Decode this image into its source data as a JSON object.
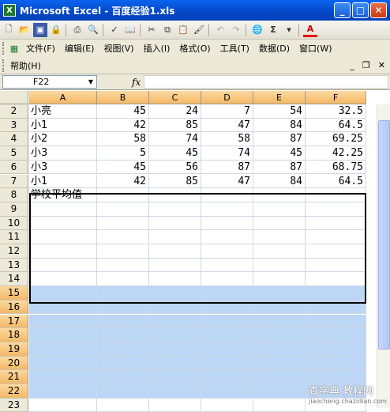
{
  "window": {
    "title": "Microsoft Excel - 百度经验1.xls",
    "app_icon": "X"
  },
  "toolbar": {
    "icons": [
      "new-icon",
      "open-icon",
      "save-icon",
      "permission-icon",
      "print-icon",
      "print-preview-icon",
      "spelling-icon",
      "research-icon",
      "cut-icon",
      "copy-icon",
      "paste-icon",
      "format-painter-icon",
      "undo-icon",
      "redo-icon",
      "hyperlink-icon",
      "autosum-icon",
      "sort-icon",
      "font-color-icon"
    ],
    "autosum_label": "Σ",
    "font_color_label": "A"
  },
  "menu": {
    "row1": [
      "文件(F)",
      "编辑(E)",
      "视图(V)",
      "插入(I)",
      "格式(O)",
      "工具(T)",
      "数据(D)",
      "窗口(W)"
    ],
    "row2": [
      "帮助(H)"
    ]
  },
  "formula_bar": {
    "name_box": "F22",
    "fx_label": "fx",
    "value": ""
  },
  "columns": [
    "A",
    "B",
    "C",
    "D",
    "E",
    "F"
  ],
  "rows": [
    {
      "n": "2",
      "cells": [
        "小亮",
        "45",
        "24",
        "7",
        "54",
        "32.5"
      ]
    },
    {
      "n": "3",
      "cells": [
        "小1",
        "42",
        "85",
        "47",
        "84",
        "64.5"
      ]
    },
    {
      "n": "4",
      "cells": [
        "小2",
        "58",
        "74",
        "58",
        "87",
        "69.25"
      ]
    },
    {
      "n": "5",
      "cells": [
        "小3",
        "5",
        "45",
        "74",
        "45",
        "42.25"
      ]
    },
    {
      "n": "6",
      "cells": [
        "小3",
        "45",
        "56",
        "87",
        "87",
        "68.75"
      ]
    },
    {
      "n": "7",
      "cells": [
        "小1",
        "42",
        "85",
        "47",
        "84",
        "64.5"
      ]
    },
    {
      "n": "8",
      "cells": [
        "学校平均值",
        "",
        "",
        "",
        "",
        ""
      ]
    },
    {
      "n": "9",
      "cells": [
        "",
        "",
        "",
        "",
        "",
        ""
      ]
    },
    {
      "n": "10",
      "cells": [
        "",
        "",
        "",
        "",
        "",
        ""
      ]
    },
    {
      "n": "11",
      "cells": [
        "",
        "",
        "",
        "",
        "",
        ""
      ]
    },
    {
      "n": "12",
      "cells": [
        "",
        "",
        "",
        "",
        "",
        ""
      ]
    },
    {
      "n": "13",
      "cells": [
        "",
        "",
        "",
        "",
        "",
        ""
      ]
    },
    {
      "n": "14",
      "cells": [
        "",
        "",
        "",
        "",
        "",
        ""
      ]
    },
    {
      "n": "15",
      "cells": [
        "",
        "",
        "",
        "",
        "",
        ""
      ]
    },
    {
      "n": "16",
      "cells": [
        "",
        "",
        "",
        "",
        "",
        ""
      ]
    },
    {
      "n": "17",
      "cells": [
        "",
        "",
        "",
        "",
        "",
        ""
      ]
    },
    {
      "n": "18",
      "cells": [
        "",
        "",
        "",
        "",
        "",
        ""
      ]
    },
    {
      "n": "19",
      "cells": [
        "",
        "",
        "",
        "",
        "",
        ""
      ]
    },
    {
      "n": "20",
      "cells": [
        "",
        "",
        "",
        "",
        "",
        ""
      ]
    },
    {
      "n": "21",
      "cells": [
        "",
        "",
        "",
        "",
        "",
        ""
      ]
    },
    {
      "n": "22",
      "cells": [
        "",
        "",
        "",
        "",
        "",
        ""
      ]
    },
    {
      "n": "23",
      "cells": [
        "",
        "",
        "",
        "",
        "",
        ""
      ]
    }
  ],
  "selection": {
    "first_row": "15",
    "last_row": "22"
  },
  "watermark": {
    "text": "查字典 教程网",
    "sub": "jiaocheng.chazidian.com"
  },
  "colors": {
    "selection_fill": "#bcd6f5",
    "header_active": "#f3b866",
    "titlebar": "#0447c4"
  }
}
